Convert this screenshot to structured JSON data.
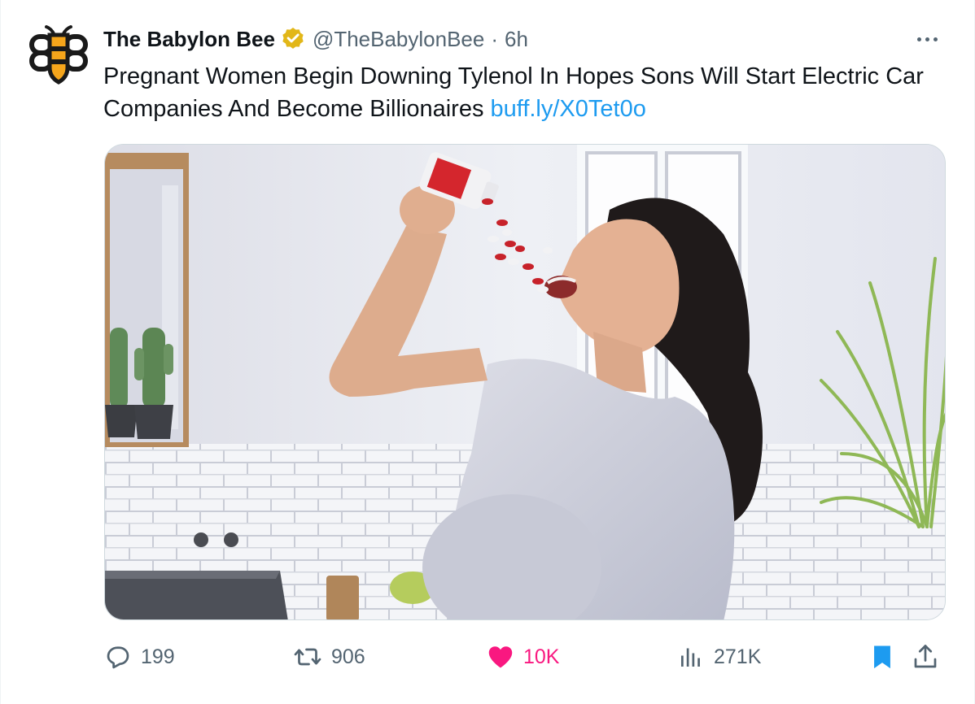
{
  "tweet": {
    "author": {
      "display_name": "The Babylon Bee",
      "handle": "@TheBabylonBee",
      "separator": "·",
      "time": "6h",
      "verified": true,
      "verified_badge_color": "#e2b719"
    },
    "text": "Pregnant Women Begin Downing Tylenol In Hopes Sons Will Start Electric Car Companies And Become Billionaires ",
    "link": "buff.ly/X0Tet0o",
    "media": {
      "type": "photo"
    },
    "actions": {
      "reply_count": "199",
      "retweet_count": "906",
      "like_count": "10K",
      "view_count": "271K",
      "liked": true,
      "bookmarked": true
    },
    "icons": {
      "reply": "reply-icon",
      "retweet": "retweet-icon",
      "like": "heart-icon",
      "views": "views-icon",
      "bookmark": "bookmark-icon",
      "share": "share-icon",
      "more": "more-icon"
    },
    "colors": {
      "link": "#1d9bf0",
      "like_active": "#f91880",
      "bookmark_active": "#1d9bf0",
      "secondary_text": "#536471"
    }
  }
}
